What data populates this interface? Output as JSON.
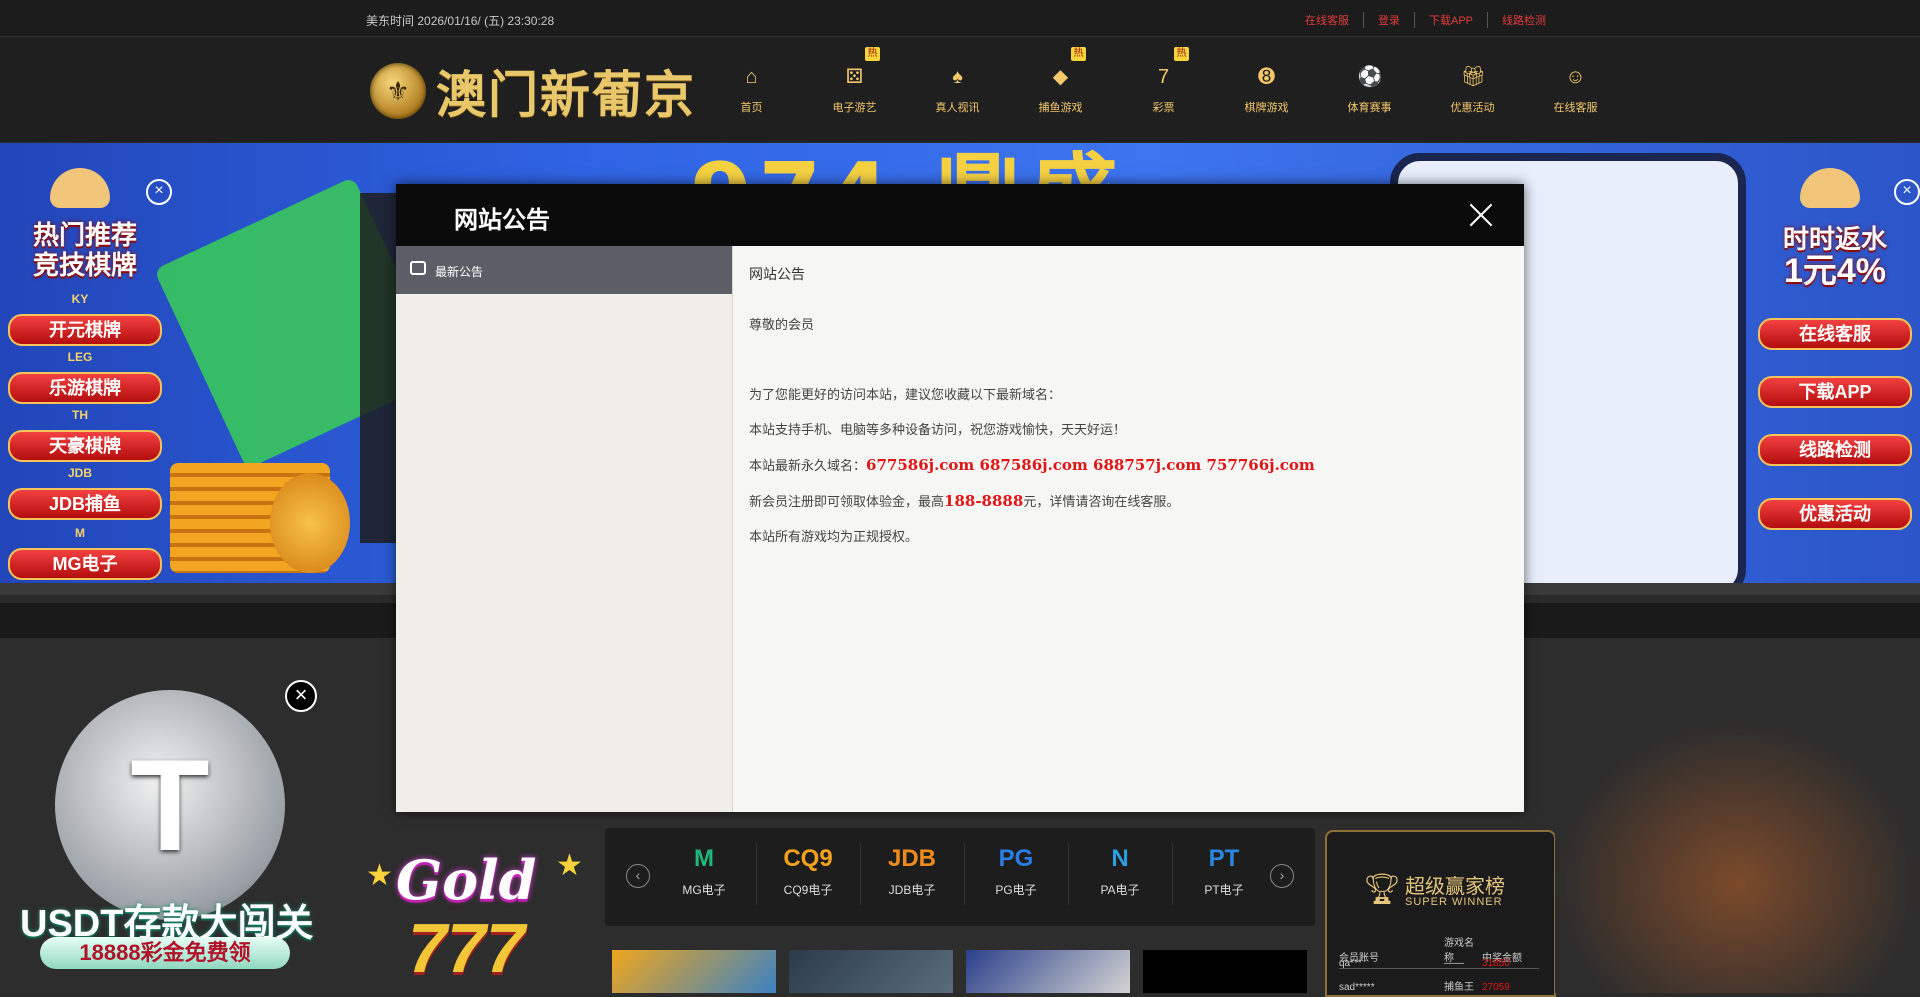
{
  "topbar": {
    "time_label": "美东时间",
    "datetime": "2026/01/16/ (五) 23:30:28",
    "links": [
      "在线客服",
      "登录",
      "下载APP",
      "线路检测"
    ]
  },
  "logo": {
    "text": "澳门新葡京"
  },
  "nav": [
    {
      "label": "首页",
      "icon": "home-icon",
      "hot": ""
    },
    {
      "label": "电子游艺",
      "icon": "dice-icon",
      "hot": "热"
    },
    {
      "label": "真人视讯",
      "icon": "cards-icon",
      "hot": ""
    },
    {
      "label": "捕鱼游戏",
      "icon": "fish-icon",
      "hot": "热"
    },
    {
      "label": "彩票",
      "icon": "lottery-icon",
      "hot": "热"
    },
    {
      "label": "棋牌游戏",
      "icon": "eight-ball-icon",
      "hot": ""
    },
    {
      "label": "体育赛事",
      "icon": "soccer-icon",
      "hot": ""
    },
    {
      "label": "优惠活动",
      "icon": "gift-icon",
      "hot": ""
    },
    {
      "label": "在线客服",
      "icon": "support-icon",
      "hot": ""
    }
  ],
  "banner": {
    "title": "974 鼎盛"
  },
  "left_floater": {
    "heading": [
      "热门推荐",
      "竞技棋牌"
    ],
    "plats": [
      "KY",
      "LEG",
      "TH",
      "JDB",
      "M"
    ],
    "buttons": [
      "开元棋牌",
      "乐游棋牌",
      "天豪棋牌",
      "JDB捕鱼",
      "MG电子"
    ]
  },
  "right_floater": {
    "heading": [
      "时时返水",
      "1元4%"
    ],
    "buttons": [
      "在线客服",
      "下载APP",
      "线路检测",
      "优惠活动"
    ]
  },
  "modal": {
    "title": "网站公告",
    "side_item": "最新公告",
    "heading": "网站公告",
    "greeting": "尊敬的会员",
    "lines": [
      {
        "text": "为了您能更好的访问本站，建议您收藏以下最新域名：",
        "red": ""
      },
      {
        "text": "本站支持手机、电脑等多种设备访问，祝您游戏愉快，天天好运！",
        "red": ""
      },
      {
        "text": "本站最新永久域名：",
        "red": "677586j.com 687586j.com 688757j.com 757766j.com",
        "after": ""
      },
      {
        "text": "新会员注册即可领取体验金，最高",
        "red": "188-8888",
        "after": "元，详情请咨询在线客服。"
      },
      {
        "text": "本站所有游戏均为正规授权。",
        "red": ""
      }
    ]
  },
  "usdt": {
    "title": "USDT存款大闯关",
    "pill": "18888彩金免费领"
  },
  "gold": {
    "word": "Gold",
    "number": "777"
  },
  "providers": [
    {
      "name": "MG电子",
      "logo": "M",
      "color": "#1fb87d"
    },
    {
      "name": "CQ9电子",
      "logo": "CQ9",
      "color": "#f5a21b"
    },
    {
      "name": "JDB电子",
      "logo": "JDB",
      "color": "#f08a1c"
    },
    {
      "name": "PG电子",
      "logo": "PG",
      "color": "#2a7de1"
    },
    {
      "name": "PA电子",
      "logo": "N",
      "color": "#2aa0e0"
    },
    {
      "name": "PT电子",
      "logo": "PT",
      "color": "#2a87e0"
    }
  ],
  "winner": {
    "title": "超级赢家榜",
    "subtitle": "SUPER WINNER",
    "headers": [
      "会员账号",
      "游戏名称",
      "中奖金额"
    ],
    "rows": [
      [
        "qa***",
        "——",
        "31850"
      ],
      [
        "sad*****",
        "捕鱼王",
        "27059"
      ]
    ]
  },
  "colors": {
    "accent_gold": "#f3c76a",
    "red": "#e01515",
    "modal_head": "#0b0b0b"
  }
}
